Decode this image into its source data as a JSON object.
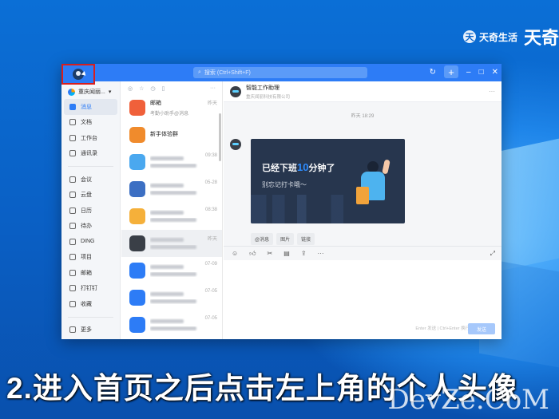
{
  "brand": {
    "badge": "天",
    "name": "天奇生活",
    "big": "天奇"
  },
  "window": {
    "search_placeholder": "搜索 (Ctrl+Shift+F)"
  },
  "nav": {
    "org_name": "重庆闻丽...",
    "items": [
      {
        "label": "消息",
        "icon": "message-icon",
        "active": true
      },
      {
        "label": "文档",
        "icon": "document-icon"
      },
      {
        "label": "工作台",
        "icon": "grid-icon"
      },
      {
        "label": "通讯录",
        "icon": "contacts-icon"
      },
      {
        "label": "会议",
        "icon": "meeting-icon"
      },
      {
        "label": "云盘",
        "icon": "cloud-icon"
      },
      {
        "label": "日历",
        "icon": "calendar-icon"
      },
      {
        "label": "待办",
        "icon": "todo-icon"
      },
      {
        "label": "DING",
        "icon": "ding-icon"
      },
      {
        "label": "项目",
        "icon": "project-icon"
      },
      {
        "label": "邮箱",
        "icon": "mail-icon"
      },
      {
        "label": "打钉钉",
        "icon": "attendance-icon"
      },
      {
        "label": "收藏",
        "icon": "star-icon"
      },
      {
        "label": "更多",
        "icon": "more-icon"
      }
    ]
  },
  "list": {
    "conversations": [
      {
        "name": "邮箱",
        "sub": "考勤小助手@消息",
        "time": "昨天",
        "color": "#f0603a"
      },
      {
        "name": "新手体验群",
        "sub": "",
        "time": "",
        "color": "#f08b2c"
      },
      {
        "name": "",
        "sub": "",
        "time": "09:38",
        "color": "#4aa8ef"
      },
      {
        "name": "",
        "sub": "",
        "time": "05-28",
        "color": "#3c6fc3"
      },
      {
        "name": "",
        "sub": "",
        "time": "08:38",
        "color": "#f5b03a"
      },
      {
        "name": "",
        "sub": "",
        "time": "昨天",
        "color": "#3a3f47"
      },
      {
        "name": "",
        "sub": "",
        "time": "07-09",
        "color": "#2d7cf6"
      },
      {
        "name": "",
        "sub": "",
        "time": "07-05",
        "color": "#2d7cf6"
      },
      {
        "name": "",
        "sub": "",
        "time": "07-05",
        "color": "#2d7cf6"
      }
    ]
  },
  "chat": {
    "title": "智能工作助理",
    "subtitle": "重庆闻丽科技有限公司",
    "timestamp": "昨天 18:29",
    "card_line1_pre": "已经下班",
    "card_line1_num": "10",
    "card_line1_post": "分钟了",
    "card_line2": "别忘记打卡哦～",
    "actions": [
      "@消息",
      "图片",
      "链接"
    ],
    "send_hint": "Enter 发送 | Ctrl+Enter 换行",
    "send_label": "发送"
  },
  "caption": "2.进入首页之后点击左上角的个人头像",
  "watermark": "DevZe.CoM"
}
